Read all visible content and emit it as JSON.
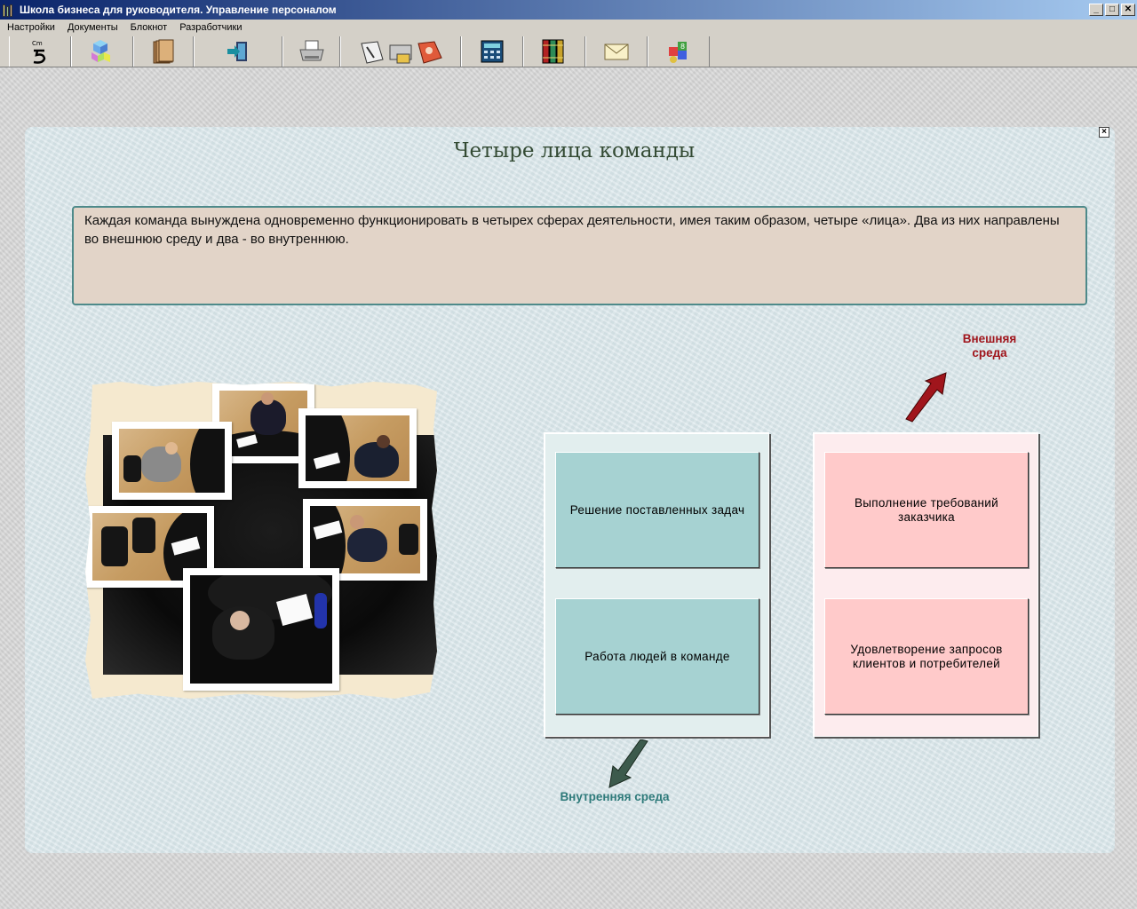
{
  "window": {
    "title": "Школа бизнеса для руководителя. Управление персоналом",
    "minimize": "_",
    "maximize": "□",
    "close": "✕"
  },
  "menu": [
    "Настройки",
    "Документы",
    "Блокнот",
    "Разработчики"
  ],
  "toolbar": {
    "icons": [
      "cmd-5-icon",
      "cubes-icon",
      "folders-icon",
      "exit-door-icon",
      "printer-icon",
      "tools-icon",
      "calculator-icon",
      "books-icon",
      "envelope-icon",
      "puzzle-icon"
    ]
  },
  "content": {
    "close": "×",
    "title": "Четыре лица команды",
    "description": "Каждая команда вынуждена одновременно функционировать в четырех сферах деятельности,  имея таким образом, четыре «лица». Два из них направлены во внешнюю среду и два - во внутреннюю.",
    "external_label": "Внешняя среда",
    "internal_label": "Внутренняя среда",
    "inner_cells": [
      "Решение поставленных задач",
      "Работа людей в команде"
    ],
    "outer_cells": [
      "Выполнение требований заказчика",
      "Удовлетворение запросов клиентов и потребителей"
    ]
  },
  "colors": {
    "inner_cell": "#a6d2d2",
    "outer_cell": "#ffcaca",
    "external_arrow": "#a0151c",
    "internal_arrow": "#3c5a4c"
  }
}
